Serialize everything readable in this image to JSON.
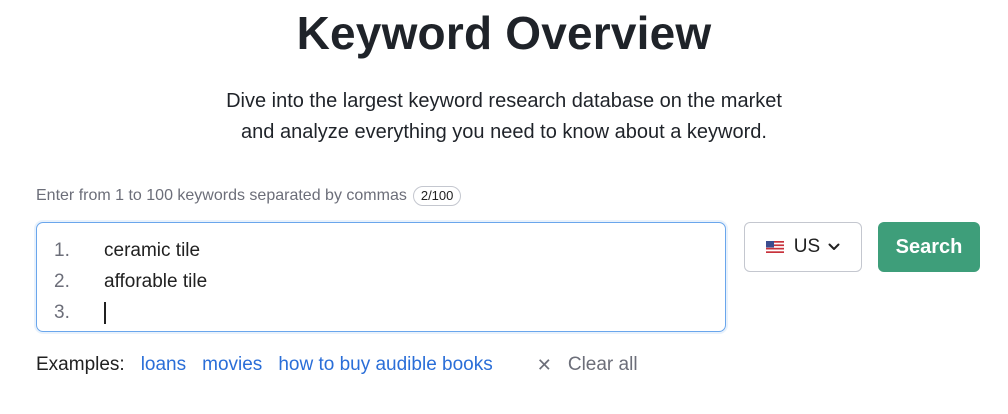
{
  "header": {
    "title": "Keyword Overview",
    "subtitle_line1": "Dive into the largest keyword research database on the market",
    "subtitle_line2": "and analyze everything you need to know about a keyword."
  },
  "keyword_input": {
    "hint": "Enter from 1 to 100 keywords separated by commas",
    "count_badge": "2/100",
    "lines": [
      {
        "num": "1.",
        "text": "ceramic tile"
      },
      {
        "num": "2.",
        "text": "afforable tile"
      },
      {
        "num": "3.",
        "text": ""
      }
    ]
  },
  "country_select": {
    "value": "US",
    "flag_icon": "us-flag-icon",
    "chevron_icon": "chevron-down-icon"
  },
  "search_button": {
    "label": "Search",
    "color": "#3e9e7a"
  },
  "examples": {
    "label": "Examples:",
    "links": [
      "loans",
      "movies",
      "how to buy audible books"
    ],
    "clear_label": "Clear all",
    "clear_icon": "close-icon"
  },
  "colors": {
    "link": "#2a6ed8",
    "focus_border": "#6aa6ec"
  }
}
